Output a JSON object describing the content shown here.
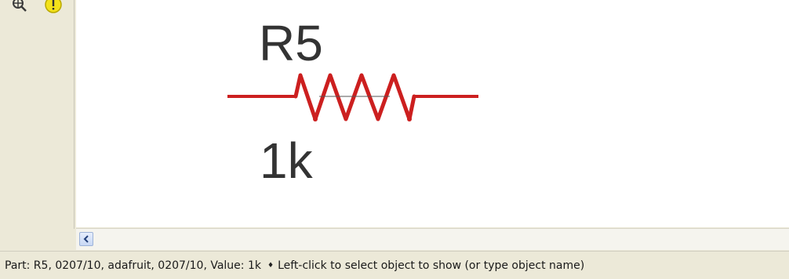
{
  "toolbar": {
    "tools": [
      {
        "icon": "show-zoom-icon"
      },
      {
        "icon": "info-warning-icon"
      }
    ]
  },
  "schematic": {
    "part_name": "R5",
    "part_value": "1k",
    "wire_color": "#cc1f1f",
    "label_color": "#333333"
  },
  "scrollbar": {
    "left_arrow_icon": "chevron-left-icon"
  },
  "status": {
    "part_info": "Part: R5, 0207/10, adafruit, 0207/10, Value: 1k",
    "separator_glyph": "♦",
    "hint": "Left-click to select object to show (or type object name)"
  }
}
